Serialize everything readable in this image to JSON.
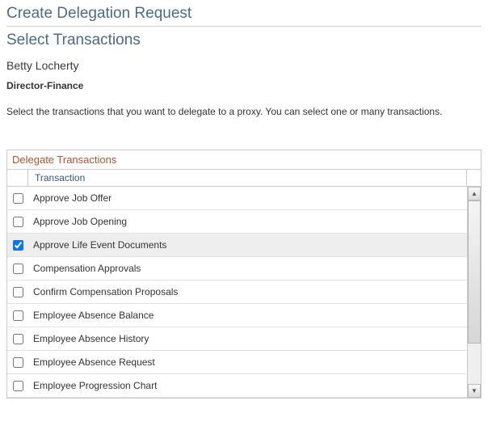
{
  "page": {
    "title": "Create Delegation Request",
    "subtitle": "Select Transactions",
    "user_name": "Betty Locherty",
    "user_role": "Director-Finance",
    "instructions": "Select the transactions that you want to delegate to a proxy. You can select one or many transactions."
  },
  "grid": {
    "caption": "Delegate Transactions",
    "column_label": "Transaction",
    "rows": [
      {
        "label": "Approve Job Offer",
        "checked": false
      },
      {
        "label": "Approve Job Opening",
        "checked": false
      },
      {
        "label": "Approve Life Event Documents",
        "checked": true
      },
      {
        "label": "Compensation Approvals",
        "checked": false
      },
      {
        "label": "Confirm Compensation Proposals",
        "checked": false
      },
      {
        "label": "Employee Absence Balance",
        "checked": false
      },
      {
        "label": "Employee Absence History",
        "checked": false
      },
      {
        "label": "Employee Absence Request",
        "checked": false
      },
      {
        "label": "Employee Progression Chart",
        "checked": false
      }
    ]
  },
  "scroll": {
    "up_glyph": "▲",
    "down_glyph": "▼"
  }
}
